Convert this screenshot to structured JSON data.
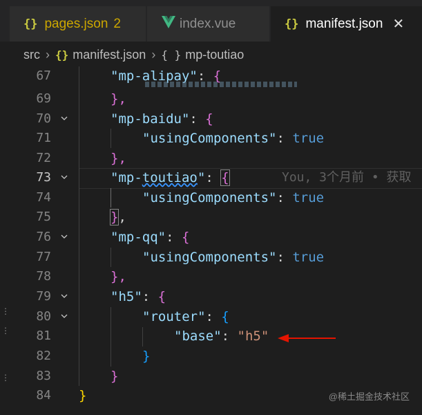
{
  "tabs": [
    {
      "icon": "{}",
      "label": "pages.json",
      "badge": "2"
    },
    {
      "label": "index.vue"
    },
    {
      "icon": "{}",
      "label": "manifest.json",
      "close": "✕"
    }
  ],
  "breadcrumb": {
    "items": [
      "src",
      "manifest.json",
      "mp-toutiao"
    ],
    "separator": "›",
    "file_icon": "{}",
    "object_icon": "{ }"
  },
  "editor": {
    "line_numbers": [
      "67",
      "69",
      "70",
      "71",
      "72",
      "73",
      "74",
      "75",
      "76",
      "77",
      "78",
      "79",
      "80",
      "81",
      "82",
      "83",
      "84"
    ],
    "code": {
      "l67_key": "\"mp-alipay\"",
      "l67_rest": ": ",
      "l67_brace": "{",
      "l69": "},",
      "l70_key": "\"mp-baidu\"",
      "l70_rest": ": ",
      "l70_brace": "{",
      "l71_key": "\"usingComponents\"",
      "l71_rest": ": ",
      "l71_val": "true",
      "l72": "},",
      "l73_key_q1": "\"",
      "l73_key_mp": "mp-",
      "l73_key_tt": "toutiao",
      "l73_key_q2": "\"",
      "l73_rest": ": ",
      "l73_brace": "{",
      "l74_key": "\"usingComponents\"",
      "l74_rest": ": ",
      "l74_val": "true",
      "l75": "}",
      "l75_comma": ",",
      "l76_key": "\"mp-qq\"",
      "l76_rest": ": ",
      "l76_brace": "{",
      "l77_key": "\"usingComponents\"",
      "l77_rest": ": ",
      "l77_val": "true",
      "l78": "},",
      "l79_key": "\"h5\"",
      "l79_rest": ": ",
      "l79_brace": "{",
      "l80_key": "\"router\"",
      "l80_rest": ": ",
      "l80_brace": "{",
      "l81_key": "\"base\"",
      "l81_rest": ": ",
      "l81_val": "\"h5\"",
      "l82": "}",
      "l83": "}",
      "l84": "}"
    },
    "blame": "You, 3个月前 • 获取"
  },
  "watermark": "@稀土掘金技术社区",
  "colors": {
    "background": "#1e1e1e",
    "key": "#9cdcfe",
    "string": "#ce9178",
    "boolean": "#569cd6",
    "brace_level1": "#ffd700",
    "brace_level2": "#da70d6",
    "brace_level3": "#179fff",
    "arrow": "#e51400"
  }
}
